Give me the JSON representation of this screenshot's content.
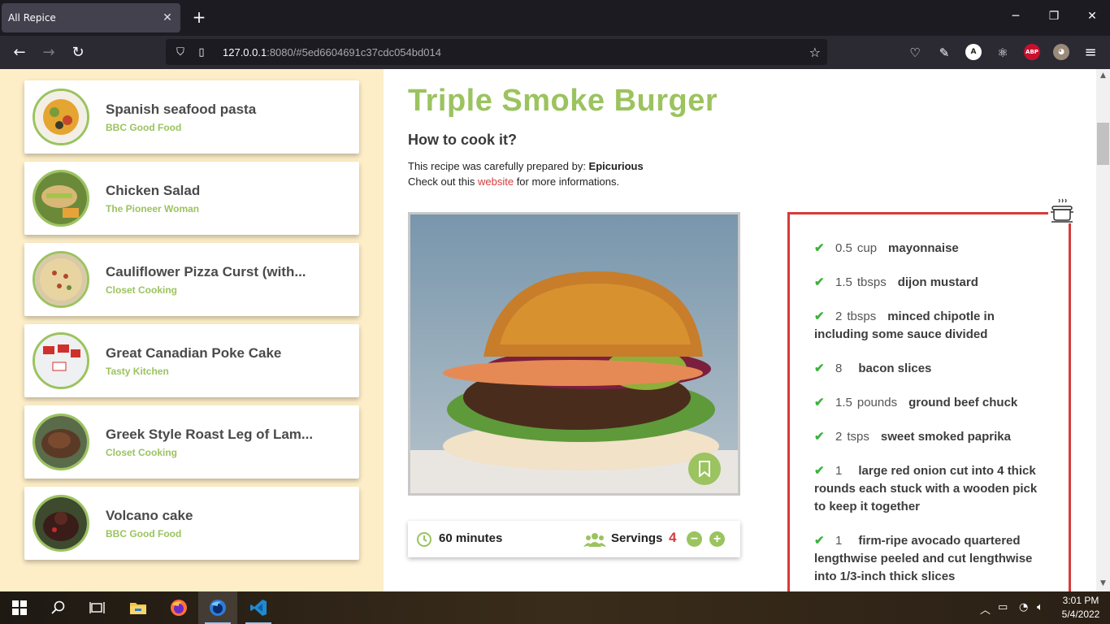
{
  "browser": {
    "tab_title": "All Repice",
    "tab_close": "✕",
    "new_tab": "+",
    "url_host": "127.0.0.1",
    "url_rest": ":8080/#5ed6604691c37cdc054bd014",
    "extensions": [
      "A",
      "ABP"
    ]
  },
  "sidebar": {
    "recipes": [
      {
        "name": "Spanish seafood pasta",
        "source": "BBC Good Food"
      },
      {
        "name": "Chicken Salad",
        "source": "The Pioneer Woman"
      },
      {
        "name": "Cauliflower Pizza Curst (with...",
        "source": "Closet Cooking"
      },
      {
        "name": "Great Canadian Poke Cake",
        "source": "Tasty Kitchen"
      },
      {
        "name": "Greek Style Roast Leg of Lam...",
        "source": "Closet Cooking"
      },
      {
        "name": "Volcano cake",
        "source": "BBC Good Food"
      }
    ]
  },
  "recipe": {
    "title": "Triple Smoke Burger",
    "subtitle": "How to cook it?",
    "prepared_by_text": "This recipe was carefully prepared by: ",
    "publisher": "Epicurious",
    "check_text": "Check out this ",
    "link_text": "website",
    "after_link_text": " for more informations.",
    "time": "60 minutes",
    "servings_label": "Servings",
    "servings": "4",
    "minus": "−",
    "plus": "+",
    "ingredients": [
      {
        "qty": "0.5",
        "unit": "cup",
        "desc": "mayonnaise"
      },
      {
        "qty": "1.5",
        "unit": "tbsps",
        "desc": "dijon mustard"
      },
      {
        "qty": "2",
        "unit": "tbsps",
        "desc": "minced chipotle in including some sauce divided"
      },
      {
        "qty": "8",
        "unit": "",
        "desc": "bacon slices"
      },
      {
        "qty": "1.5",
        "unit": "pounds",
        "desc": "ground beef chuck"
      },
      {
        "qty": "2",
        "unit": "tsps",
        "desc": "sweet smoked paprika"
      },
      {
        "qty": "1",
        "unit": "",
        "desc": "large red onion cut into 4 thick rounds each stuck with a wooden pick to keep it together"
      },
      {
        "qty": "1",
        "unit": "",
        "desc": "firm-ripe avocado quartered lengthwise peeled and cut lengthwise into 1/3-inch thick slices"
      }
    ]
  },
  "taskbar": {
    "time": "3:01 PM",
    "date": "5/4/2022"
  },
  "colors": {
    "accent": "#9bc35f",
    "red": "#d83a3a",
    "sidebar_bg": "#fdeec8"
  }
}
